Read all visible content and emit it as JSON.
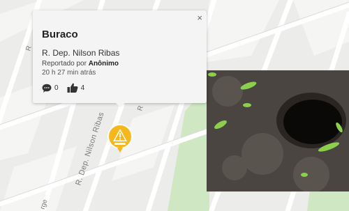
{
  "popup": {
    "title": "Buraco",
    "address": "R. Dep. Nilson Ribas",
    "reported_prefix": "Reportado por",
    "reporter": "Anônimo",
    "time_ago": "20 h 27 min atrás",
    "comments_count": "0",
    "likes_count": "4",
    "close_label": "×"
  },
  "map": {
    "streets": {
      "main": "R. Dep. Nilson Ribas",
      "upper_left": "R",
      "popup_side": "R",
      "bottom_left": "rge"
    }
  },
  "icons": {
    "marker": "warning-triangle-icon",
    "comments": "speech-bubble-icon",
    "likes": "thumbs-up-icon",
    "close": "close-icon"
  },
  "colors": {
    "marker": "#f5b81c",
    "map_bg": "#ececea",
    "park": "#cfe8c3",
    "popup_bg": "#f4f4f4"
  }
}
